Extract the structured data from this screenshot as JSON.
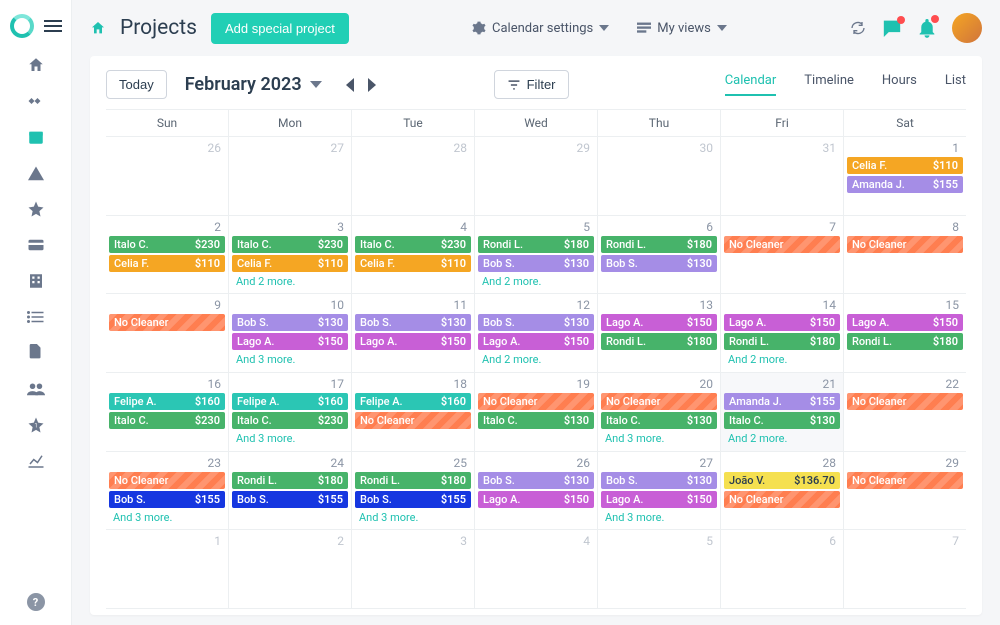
{
  "header": {
    "title": "Projects",
    "add_label": "Add special project",
    "calendar_settings": "Calendar settings",
    "my_views": "My views"
  },
  "toolbar": {
    "today": "Today",
    "month": "February 2023",
    "filter": "Filter"
  },
  "views": {
    "calendar": "Calendar",
    "timeline": "Timeline",
    "hours": "Hours",
    "list": "List"
  },
  "dow": [
    "Sun",
    "Mon",
    "Tue",
    "Wed",
    "Thu",
    "Fri",
    "Sat"
  ],
  "more_label_prefix": "And ",
  "more_label_suffix": " more.",
  "weeks": [
    [
      {
        "day": "26",
        "muted": true,
        "events": []
      },
      {
        "day": "27",
        "muted": true,
        "events": []
      },
      {
        "day": "28",
        "muted": true,
        "events": []
      },
      {
        "day": "29",
        "muted": true,
        "events": []
      },
      {
        "day": "30",
        "muted": true,
        "events": []
      },
      {
        "day": "31",
        "muted": true,
        "events": []
      },
      {
        "day": "1",
        "events": [
          {
            "name": "Celia F.",
            "price": "$110",
            "color": "c-orange"
          },
          {
            "name": "Amanda J.",
            "price": "$155",
            "color": "c-lav"
          }
        ]
      }
    ],
    [
      {
        "day": "2",
        "events": [
          {
            "name": "Italo C.",
            "price": "$230",
            "color": "c-green"
          },
          {
            "name": "Celia F.",
            "price": "$110",
            "color": "c-orange"
          }
        ]
      },
      {
        "day": "3",
        "events": [
          {
            "name": "Italo C.",
            "price": "$230",
            "color": "c-green"
          },
          {
            "name": "Celia F.",
            "price": "$110",
            "color": "c-orange"
          }
        ],
        "more": 2
      },
      {
        "day": "4",
        "events": [
          {
            "name": "Italo C.",
            "price": "$230",
            "color": "c-green"
          },
          {
            "name": "Celia F.",
            "price": "$110",
            "color": "c-orange"
          }
        ]
      },
      {
        "day": "5",
        "events": [
          {
            "name": "Rondi L.",
            "price": "$180",
            "color": "c-green"
          },
          {
            "name": "Bob S.",
            "price": "$130",
            "color": "c-lav"
          }
        ],
        "more": 2
      },
      {
        "day": "6",
        "events": [
          {
            "name": "Rondi L.",
            "price": "$180",
            "color": "c-green"
          },
          {
            "name": "Bob S.",
            "price": "$130",
            "color": "c-lav"
          }
        ]
      },
      {
        "day": "7",
        "events": [
          {
            "name": "No Cleaner",
            "price": "",
            "color": "c-nocleaner"
          }
        ]
      },
      {
        "day": "8",
        "events": [
          {
            "name": "No Cleaner",
            "price": "",
            "color": "c-nocleaner"
          }
        ]
      }
    ],
    [
      {
        "day": "9",
        "events": [
          {
            "name": "No Cleaner",
            "price": "",
            "color": "c-nocleaner"
          }
        ]
      },
      {
        "day": "10",
        "events": [
          {
            "name": "Bob S.",
            "price": "$130",
            "color": "c-lav"
          },
          {
            "name": "Lago A.",
            "price": "$150",
            "color": "c-mag"
          }
        ],
        "more": 3
      },
      {
        "day": "11",
        "events": [
          {
            "name": "Bob S.",
            "price": "$130",
            "color": "c-lav"
          },
          {
            "name": "Lago A.",
            "price": "$150",
            "color": "c-mag"
          }
        ]
      },
      {
        "day": "12",
        "events": [
          {
            "name": "Bob S.",
            "price": "$130",
            "color": "c-lav"
          },
          {
            "name": "Lago A.",
            "price": "$150",
            "color": "c-mag"
          }
        ],
        "more": 2
      },
      {
        "day": "13",
        "events": [
          {
            "name": "Lago A.",
            "price": "$150",
            "color": "c-mag"
          },
          {
            "name": "Rondi L.",
            "price": "$180",
            "color": "c-green"
          }
        ]
      },
      {
        "day": "14",
        "events": [
          {
            "name": "Lago A.",
            "price": "$150",
            "color": "c-mag"
          },
          {
            "name": "Rondi L.",
            "price": "$180",
            "color": "c-green"
          }
        ],
        "more": 2
      },
      {
        "day": "15",
        "events": [
          {
            "name": "Lago A.",
            "price": "$150",
            "color": "c-mag"
          },
          {
            "name": "Rondi L.",
            "price": "$180",
            "color": "c-green"
          }
        ]
      }
    ],
    [
      {
        "day": "16",
        "events": [
          {
            "name": "Felipe A.",
            "price": "$160",
            "color": "c-teal"
          },
          {
            "name": "Italo C.",
            "price": "$230",
            "color": "c-green"
          }
        ]
      },
      {
        "day": "17",
        "events": [
          {
            "name": "Felipe A.",
            "price": "$160",
            "color": "c-teal"
          },
          {
            "name": "Italo C.",
            "price": "$230",
            "color": "c-green"
          }
        ],
        "more": 3
      },
      {
        "day": "18",
        "events": [
          {
            "name": "Felipe A.",
            "price": "$160",
            "color": "c-teal"
          },
          {
            "name": "No Cleaner",
            "price": "",
            "color": "c-nocleaner"
          }
        ]
      },
      {
        "day": "19",
        "events": [
          {
            "name": "No Cleaner",
            "price": "",
            "color": "c-nocleaner"
          },
          {
            "name": "Italo C.",
            "price": "$130",
            "color": "c-green"
          }
        ]
      },
      {
        "day": "20",
        "events": [
          {
            "name": "No Cleaner",
            "price": "",
            "color": "c-nocleaner"
          },
          {
            "name": "Italo C.",
            "price": "$130",
            "color": "c-green"
          }
        ],
        "more": 3
      },
      {
        "day": "21",
        "grey": true,
        "events": [
          {
            "name": "Amanda J.",
            "price": "$155",
            "color": "c-lav"
          },
          {
            "name": "Italo C.",
            "price": "$130",
            "color": "c-green"
          }
        ],
        "more": 2
      },
      {
        "day": "22",
        "events": [
          {
            "name": "No Cleaner",
            "price": "",
            "color": "c-nocleaner"
          }
        ]
      }
    ],
    [
      {
        "day": "23",
        "events": [
          {
            "name": "No Cleaner",
            "price": "",
            "color": "c-nocleaner"
          },
          {
            "name": "Bob S.",
            "price": "$155",
            "color": "c-blue"
          }
        ],
        "more": 3
      },
      {
        "day": "24",
        "events": [
          {
            "name": "Rondi L.",
            "price": "$180",
            "color": "c-green"
          },
          {
            "name": "Bob S.",
            "price": "$155",
            "color": "c-blue"
          }
        ]
      },
      {
        "day": "25",
        "events": [
          {
            "name": "Rondi L.",
            "price": "$180",
            "color": "c-green"
          },
          {
            "name": "Bob S.",
            "price": "$155",
            "color": "c-blue"
          }
        ],
        "more": 3
      },
      {
        "day": "26",
        "events": [
          {
            "name": "Bob S.",
            "price": "$130",
            "color": "c-lav"
          },
          {
            "name": "Lago A.",
            "price": "$150",
            "color": "c-mag"
          }
        ]
      },
      {
        "day": "27",
        "events": [
          {
            "name": "Bob S.",
            "price": "$130",
            "color": "c-lav"
          },
          {
            "name": "Lago A.",
            "price": "$150",
            "color": "c-mag"
          }
        ],
        "more": 3
      },
      {
        "day": "28",
        "events": [
          {
            "name": "João V.",
            "price": "$136.70",
            "color": "c-yellow"
          },
          {
            "name": "No Cleaner",
            "price": "",
            "color": "c-nocleaner"
          }
        ]
      },
      {
        "day": "29",
        "events": [
          {
            "name": "No Cleaner",
            "price": "",
            "color": "c-nocleaner"
          }
        ]
      }
    ],
    [
      {
        "day": "1",
        "muted": true,
        "events": []
      },
      {
        "day": "2",
        "muted": true,
        "events": []
      },
      {
        "day": "3",
        "muted": true,
        "events": []
      },
      {
        "day": "4",
        "muted": true,
        "events": []
      },
      {
        "day": "5",
        "muted": true,
        "events": []
      },
      {
        "day": "6",
        "muted": true,
        "events": []
      },
      {
        "day": "7",
        "muted": true,
        "events": []
      }
    ]
  ]
}
